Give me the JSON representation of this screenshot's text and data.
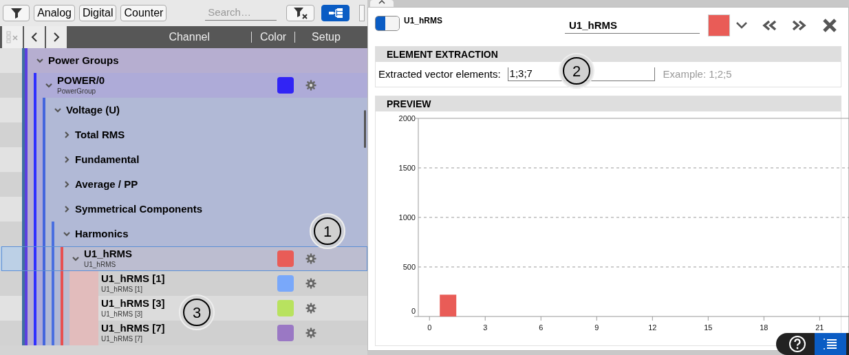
{
  "toolbar": {
    "filter_tags": [
      "Analog",
      "Digital",
      "Counter"
    ],
    "search": {
      "placeholder": "Search…"
    },
    "tree_view": {
      "on": true
    }
  },
  "columns": [
    "Channel",
    "Color",
    "Setup"
  ],
  "tree": [
    {
      "label": "Power Groups",
      "expanded": true,
      "selected": false,
      "children": [
        {
          "label": "POWER/0",
          "sublabel": "PowerGroup",
          "color": "#3124f5",
          "expanded": true,
          "selected": false,
          "children": [
            {
              "label": "Voltage (U)",
              "expanded": true,
              "selected": false,
              "children": [
                {
                  "label": "Total RMS",
                  "expanded": false,
                  "selected": false
                },
                {
                  "label": "Fundamental",
                  "expanded": false,
                  "selected": false
                },
                {
                  "label": "Average / PP",
                  "expanded": false,
                  "selected": false
                },
                {
                  "label": "Symmetrical Components",
                  "expanded": false,
                  "selected": false
                },
                {
                  "label": "Harmonics",
                  "expanded": true,
                  "selected": false,
                  "children": [
                    {
                      "label": "U1_hRMS",
                      "sublabel": "U1_hRMS",
                      "color": "#e95c57",
                      "expanded": true,
                      "selected": true,
                      "children": [
                        {
                          "label": "U1_hRMS [1]",
                          "sublabel": "U1_hRMS [1]",
                          "color": "#79a8fa",
                          "selected": false
                        },
                        {
                          "label": "U1_hRMS [3]",
                          "sublabel": "U1_hRMS [3]",
                          "color": "#b8e25f",
                          "selected": false
                        },
                        {
                          "label": "U1_hRMS [7]",
                          "sublabel": "U1_hRMS [7]",
                          "color": "#9a78c4",
                          "selected": false
                        }
                      ]
                    }
                  ]
                }
              ]
            }
          ]
        }
      ]
    }
  ],
  "detail": {
    "enabled": true,
    "title": "U1_hRMS",
    "name": "U1_hRMS",
    "color": "#e95c57",
    "extraction": {
      "heading": "ELEMENT EXTRACTION",
      "label": "Extracted vector elements:",
      "value": "1;3;7",
      "example": "Example: 1;2;5"
    },
    "preview": {
      "heading": "PREVIEW",
      "chart_data": {
        "type": "bar",
        "x": [
          1
        ],
        "series": [
          {
            "color": "#e95c57",
            "values": [
              220
            ]
          }
        ],
        "grid": true,
        "xlim": [
          -0.6,
          22.8
        ],
        "ylim": [
          0,
          2000
        ],
        "xticks": [
          0,
          3,
          6,
          9,
          12,
          15,
          18,
          21
        ],
        "yticks": [
          0,
          500,
          1000,
          1500,
          2000
        ]
      }
    }
  },
  "callouts": [
    "1",
    "2",
    "3"
  ]
}
